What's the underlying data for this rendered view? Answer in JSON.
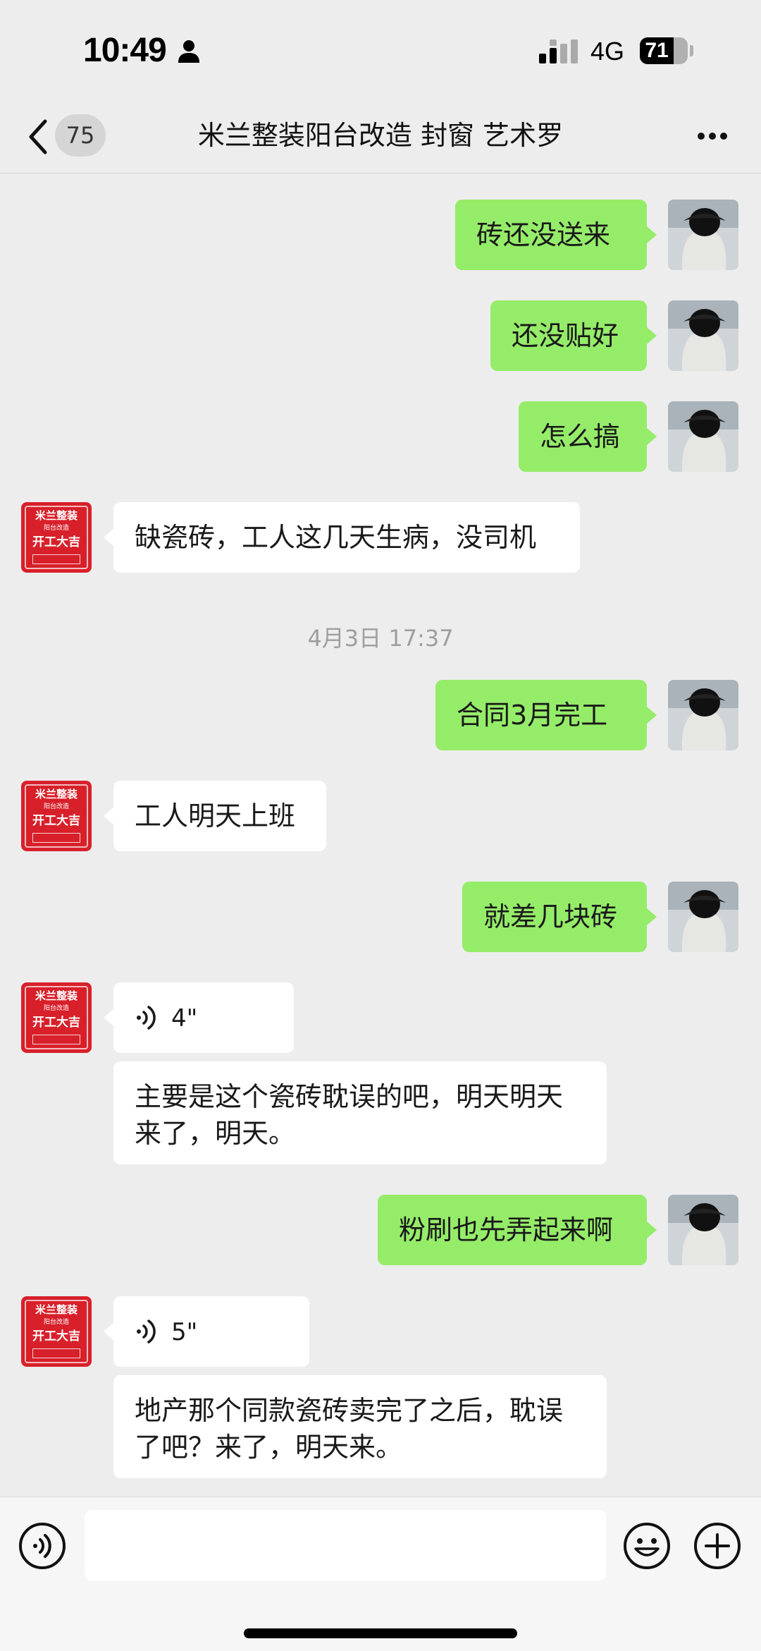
{
  "status_bar": {
    "time": "10:49",
    "network": "4G",
    "battery": "71",
    "battery_level": 0.71
  },
  "nav": {
    "unread_count": "75",
    "title": "米兰整装阳台改造  封窗  艺术罗"
  },
  "avatar_other": {
    "line1": "米兰整装",
    "line2": "阳台改造",
    "line3": "开工大吉",
    "color": "#d8202a"
  },
  "messages": [
    {
      "side": "self",
      "text": "砖还没送来"
    },
    {
      "side": "self",
      "text": "还没贴好"
    },
    {
      "side": "self",
      "text": "怎么搞"
    },
    {
      "side": "other",
      "text": "缺瓷砖，工人这几天生病，没司机"
    },
    {
      "type": "time",
      "text": "4月3日 17:37"
    },
    {
      "side": "self",
      "text": "合同3月完工"
    },
    {
      "side": "other",
      "text": "工人明天上班"
    },
    {
      "side": "self",
      "text": "就差几块砖"
    },
    {
      "side": "other",
      "type": "voice",
      "duration": "4\""
    },
    {
      "side": "other",
      "text": "主要是这个瓷砖耽误的吧，明天明天\n来了，明天。"
    },
    {
      "side": "self",
      "text": "粉刷也先弄起来啊"
    },
    {
      "side": "other",
      "type": "voice",
      "duration": "5\""
    },
    {
      "side": "other",
      "text": "地产那个同款瓷砖卖完了之后，耽误\n了吧？来了，明天来。"
    }
  ],
  "colors": {
    "self_bubble": "#95ec69",
    "other_bubble": "#ffffff",
    "background": "#ededed"
  },
  "icons": {
    "back": "chevron-left-icon",
    "more": "more-dots-icon",
    "voice_input": "voice-input-icon",
    "emoji": "emoji-icon",
    "plus": "plus-icon"
  }
}
